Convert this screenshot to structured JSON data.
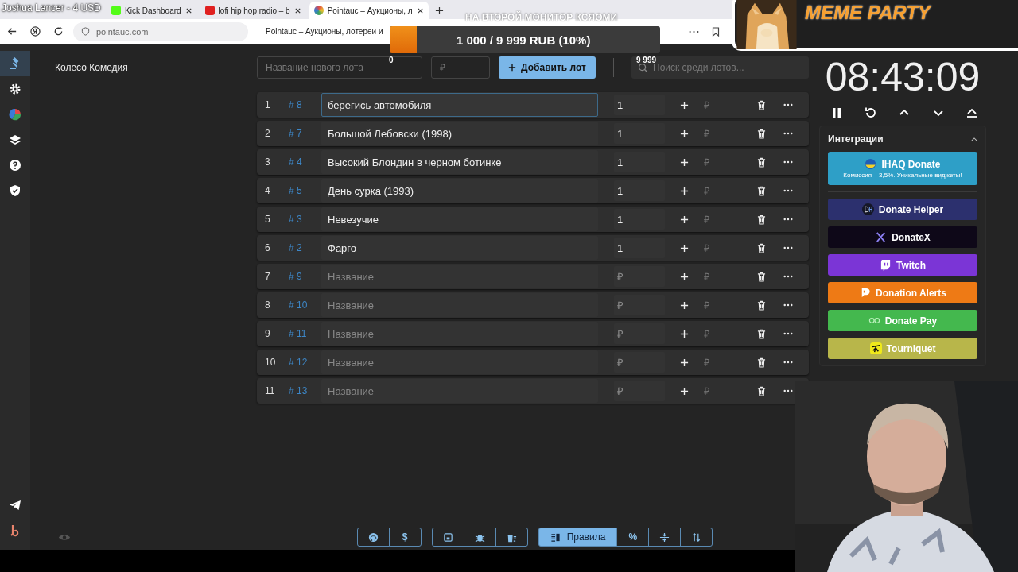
{
  "browser": {
    "tabs": [
      {
        "title": "Kick Dashboard",
        "selected": false,
        "kind": "kick"
      },
      {
        "title": "lofi hip hop radio – b",
        "selected": false,
        "kind": "youtube"
      },
      {
        "title": "Pointauc – Аукционы, л",
        "selected": true,
        "kind": "pointauc"
      }
    ],
    "address": "pointauc.com",
    "page_title": "Pointauc – Аукционы, лотереи и"
  },
  "overlays": {
    "donor": "Joshua Lancer - 4 USD",
    "caption": "НА ВТОРОЙ МОНИТОР КСЯОМИ",
    "goal": {
      "text": "1 000 / 9 999 RUB (10%)",
      "level": 0.1,
      "min": "0",
      "max": "9 999"
    },
    "meme_title": "MEME PARTY"
  },
  "sidebar": {
    "items": [
      {
        "kind": "gavel",
        "selected": true
      },
      {
        "kind": "gear",
        "selected": false
      },
      {
        "kind": "pie",
        "selected": false
      },
      {
        "kind": "layers",
        "selected": false
      },
      {
        "kind": "help",
        "selected": false
      },
      {
        "kind": "shield",
        "selected": false
      }
    ],
    "bottom": [
      {
        "kind": "telegram"
      },
      {
        "kind": "logo"
      }
    ]
  },
  "title": "Колесо Комедия",
  "new_lot": {
    "placeholder": "Название нового лота",
    "amount_placeholder": "₽",
    "add_button": "Добавить лот"
  },
  "search": {
    "placeholder": "Поиск среди лотов..."
  },
  "lots": [
    {
      "index": "1",
      "id": "# 8",
      "name": "берегись автомобиля",
      "amount": "1",
      "selected": true
    },
    {
      "index": "2",
      "id": "# 7",
      "name": "Большой Лебовски (1998)",
      "amount": "1",
      "selected": false
    },
    {
      "index": "3",
      "id": "# 4",
      "name": "Высокий Блондин в черном ботинке",
      "amount": "1",
      "selected": false
    },
    {
      "index": "4",
      "id": "# 5",
      "name": "День сурка (1993)",
      "amount": "1",
      "selected": false
    },
    {
      "index": "5",
      "id": "# 3",
      "name": "Невезучие",
      "amount": "1",
      "selected": false
    },
    {
      "index": "6",
      "id": "# 2",
      "name": "Фарго",
      "amount": "1",
      "selected": false
    },
    {
      "index": "7",
      "id": "# 9",
      "placeholder": "Название",
      "amount_placeholder": "₽",
      "selected": false
    },
    {
      "index": "8",
      "id": "# 10",
      "placeholder": "Название",
      "amount_placeholder": "₽",
      "selected": false
    },
    {
      "index": "9",
      "id": "# 11",
      "placeholder": "Название",
      "amount_placeholder": "₽",
      "selected": false
    },
    {
      "index": "10",
      "id": "# 12",
      "placeholder": "Название",
      "amount_placeholder": "₽",
      "selected": false
    },
    {
      "index": "11",
      "id": "# 13",
      "placeholder": "Название",
      "amount_placeholder": "₽",
      "selected": false
    }
  ],
  "add_symbol": "₽",
  "timer": "08:43:09",
  "timer_controls": [
    {
      "kind": "pause"
    },
    {
      "kind": "restart"
    },
    {
      "kind": "up"
    },
    {
      "kind": "down"
    },
    {
      "kind": "eject"
    }
  ],
  "integrations": {
    "title": "Интеграции",
    "expanded": true,
    "items": [
      {
        "label": "IHAQ Donate",
        "sub": "Комиссия – 3,5%. Уникальные виджеты!",
        "color": "#2e9fc7",
        "kind": "ihaq"
      },
      {
        "label": "Donate Helper",
        "color": "#2c306e",
        "kind": "dh"
      },
      {
        "label": "DonateX",
        "color": "#0e0818",
        "kind": "x"
      },
      {
        "label": "Twitch",
        "color": "#7b35d6",
        "kind": "twitch"
      },
      {
        "label": "Donation Alerts",
        "color": "#ee7a15",
        "kind": "da"
      },
      {
        "label": "Donate Pay",
        "color": "#44b84e",
        "kind": "dp"
      },
      {
        "label": "Tourniquet",
        "color": "#b8b64a",
        "kind": "tq"
      }
    ]
  },
  "toolbar": [
    [
      {
        "kind": "github",
        "selected": false
      },
      {
        "kind": "text",
        "label": "$",
        "selected": false
      }
    ],
    [
      {
        "kind": "save",
        "selected": false
      },
      {
        "kind": "bug",
        "selected": false
      },
      {
        "kind": "clear",
        "selected": false
      }
    ],
    [
      {
        "kind": "rules",
        "label": "Правила",
        "selected": true
      },
      {
        "kind": "text",
        "label": "%",
        "selected": false
      },
      {
        "kind": "compress",
        "selected": false
      },
      {
        "kind": "sort",
        "selected": false
      }
    ]
  ]
}
